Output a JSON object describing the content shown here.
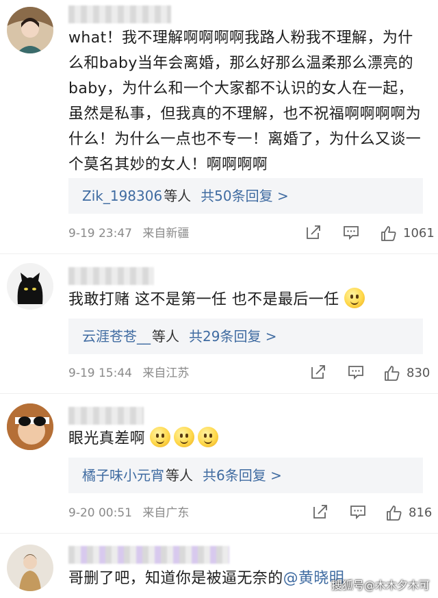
{
  "comments": [
    {
      "username": "",
      "text": "what！我不理解啊啊啊啊我路人粉我不理解，为什么和baby当年会离婚，那么好那么温柔那么漂亮的baby，为什么和一个大家都不认识的女人在一起，虽然是私事，但我真的不理解，也不祝福啊啊啊啊为什么！为什么一点也不专一！离婚了，为什么又谈一个莫名其妙的女人！啊啊啊啊",
      "replies": {
        "names": "Zik_198306",
        "others": "等人",
        "count": "共50条回复 >"
      },
      "time": "9-19 23:47",
      "location": "来自新疆",
      "likes": "1061"
    },
    {
      "username": "",
      "text": "我敢打赌 这不是第一任 也不是最后一任",
      "replies": {
        "names": "云涯苍苍__",
        "others": "等人",
        "count": "共29条回复 >"
      },
      "time": "9-19 15:44",
      "location": "来自江苏",
      "likes": "830"
    },
    {
      "username": "",
      "text": "眼光真差啊",
      "replies": {
        "names": "橘子味小元宵",
        "others": "等人",
        "count": "共6条回复 >"
      },
      "time": "9-20 00:51",
      "location": "来自广东",
      "likes": "816"
    },
    {
      "username": "",
      "text": "哥删了吧，知道你是被逼无奈的",
      "mention": "@黄晓明"
    }
  ],
  "watermark": "搜狐号@木木夕木可",
  "icons": [
    "share-icon",
    "comment-icon",
    "like-icon",
    "smile-emoji-icon"
  ]
}
